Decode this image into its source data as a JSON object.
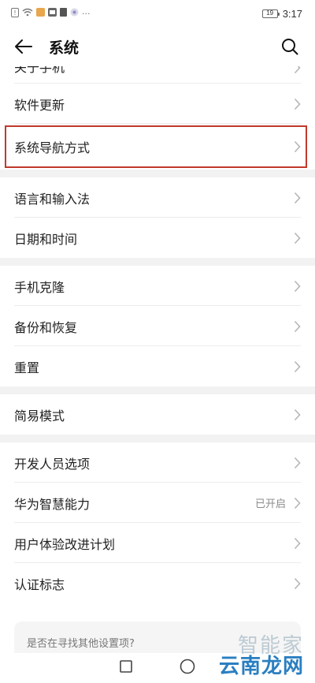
{
  "status_bar": {
    "time": "3:17",
    "battery_level": "19",
    "left_icons": [
      "sim-error-icon",
      "wifi-icon",
      "app-notification-icon",
      "app-notification-icon",
      "app-notification-icon",
      "app-notification-icon"
    ],
    "more": "···"
  },
  "header": {
    "title": "系统",
    "back_icon": "arrow-left-icon",
    "search_icon": "search-icon"
  },
  "partial_row": {
    "label": "关于手机"
  },
  "groups": [
    {
      "items": [
        {
          "label": "软件更新"
        },
        {
          "label": "系统导航方式",
          "highlighted": true
        }
      ]
    },
    {
      "items": [
        {
          "label": "语言和输入法"
        },
        {
          "label": "日期和时间"
        }
      ]
    },
    {
      "items": [
        {
          "label": "手机克隆"
        },
        {
          "label": "备份和恢复"
        },
        {
          "label": "重置"
        }
      ]
    },
    {
      "items": [
        {
          "label": "简易模式"
        }
      ]
    },
    {
      "items": [
        {
          "label": "开发人员选项"
        },
        {
          "label": "华为智慧能力",
          "value": "已开启"
        },
        {
          "label": "用户体验改进计划"
        },
        {
          "label": "认证标志"
        }
      ]
    }
  ],
  "suggest": {
    "text": "是否在寻找其他设置项?"
  },
  "watermark": {
    "top": "智能家",
    "bottom": "云南龙网"
  },
  "colors": {
    "highlight_border": "#c0392b",
    "watermark_blue": "#2a7fc1"
  }
}
